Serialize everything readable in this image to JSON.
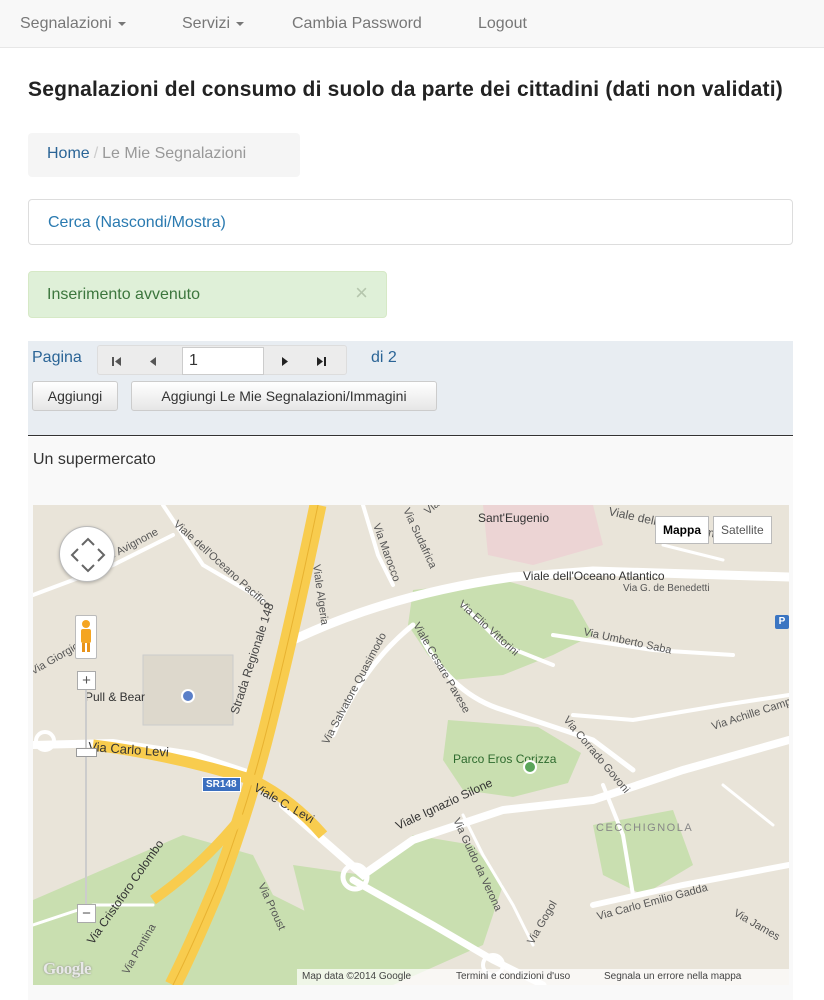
{
  "navbar": {
    "items": [
      {
        "label": "Segnalazioni",
        "dropdown": true
      },
      {
        "label": "Servizi",
        "dropdown": true
      },
      {
        "label": "Cambia Password",
        "dropdown": false
      },
      {
        "label": "Logout",
        "dropdown": false
      }
    ]
  },
  "page": {
    "title": "Segnalazioni del consumo di suolo da parte dei cittadini (dati non validati)"
  },
  "breadcrumb": {
    "home": "Home",
    "separator": "/",
    "current": "Le Mie Segnalazioni"
  },
  "search_panel": {
    "label": "Cerca (Nascondi/Mostra)"
  },
  "alert": {
    "message": "Inserimento avvenuto",
    "close": "×"
  },
  "pager": {
    "label": "Pagina",
    "current_page": "1",
    "total_label": "di 2",
    "icons": [
      "first-page-icon",
      "previous-page-icon",
      "next-page-icon",
      "last-page-icon"
    ]
  },
  "toolbar": {
    "add_label": "Aggiungi",
    "add_mine_label": "Aggiungi Le Mie Segnalazioni/Immagini"
  },
  "record": {
    "title": "Un supermercato"
  },
  "map": {
    "type_controls": {
      "map": "Mappa",
      "satellite": "Satellite",
      "selected": "Mappa"
    },
    "zoom_in": "+",
    "zoom_out": "−",
    "logo": "Google",
    "attribution": {
      "data": "Map data ©2014 Google",
      "terms": "Termini e condizioni d'uso",
      "report": "Segnala un errore nella mappa"
    },
    "route_shield": "SR148",
    "poi_badge": "P",
    "labels": [
      "Viale dell'Oceano Atlantico",
      "Via G. de Benedetti",
      "Sant'Eugenio",
      "Viale dell'Umanesimo",
      "Viale dell'Oceano Pacifico",
      "Viale Avignone",
      "Strada Regionale 148",
      "Viale Algeria",
      "Via Marocco",
      "Via Sudafrica",
      "Via Kenia",
      "Via Elio Vittorini",
      "Via Umberto Saba",
      "Viale Cesare Pavese",
      "Via Salvatore Quasimodo",
      "Via Carlo Levi",
      "Pull & Bear",
      "Via Corrado Govoni",
      "Via Achille Campanile",
      "Parco Eros Corizza",
      "Viale Ignazio Silone",
      "CECCHIGNOLA",
      "Via Guido da Verona",
      "Viale C. Levi",
      "Via Cristoforo Colombo",
      "Via Carlo Emilio Gadda",
      "Via Proust",
      "Via Pontina",
      "Via James",
      "Via Gogol",
      "Via Giorgio"
    ]
  },
  "colors": {
    "link": "#2a6496",
    "alert_bg": "#dff0d8",
    "alert_text": "#3c763d",
    "toolbar_bg": "#e8edf2",
    "highway": "#f8cc4e",
    "park": "#c9dfb0",
    "road": "#ffffff",
    "land": "#e9e4d9"
  }
}
